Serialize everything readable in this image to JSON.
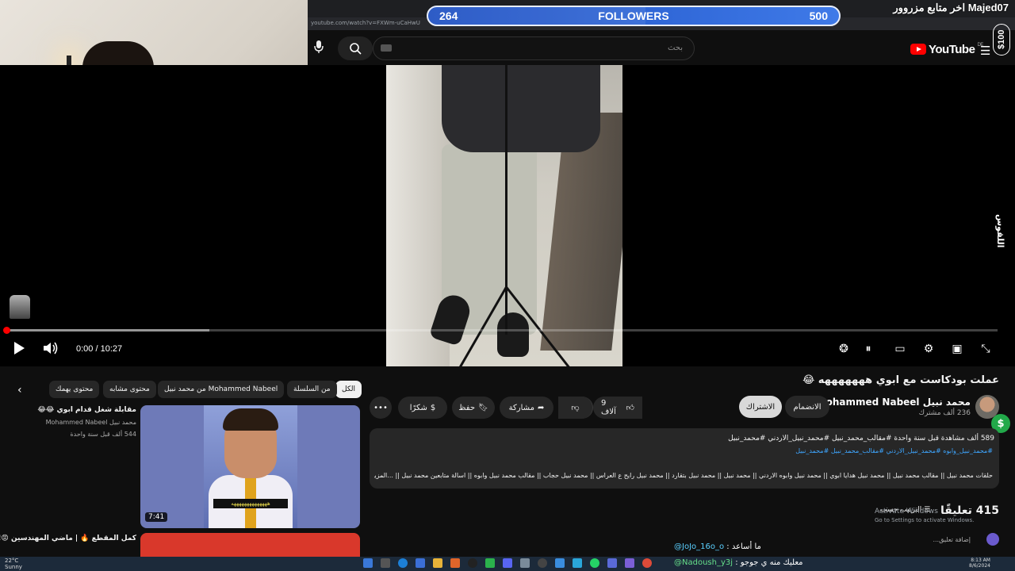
{
  "stream_overlay": {
    "followers_current": "264",
    "followers_label": "FOLLOWERS",
    "followers_goal": "500",
    "followers_progress": 0.528,
    "last_follower": "اخر متابع مزروور Majed07",
    "donation_amount": "$100",
    "vertical_label": "اللقوس",
    "dollar_badge": "$"
  },
  "browser": {
    "url": "youtube.com/watch?v=FXWm-uCaHwU"
  },
  "header": {
    "search_placeholder": "بحث",
    "logo_text": "YouTube",
    "logo_region": "DE"
  },
  "player": {
    "time": "0:00 / 10:27",
    "progress": 0.0
  },
  "video": {
    "title": "عملت بودكاست مع ابوي هههههههه 😂",
    "channel_name": "محمد نبيل Mohammed Nabeel",
    "subscribers": "236 ألف مشترك",
    "join_label": "الانضمام",
    "subscribe_label": "الاشتراك",
    "like_count": "9 آلاف",
    "share_label": "مشاركة",
    "save_label": "حفظ",
    "thanks_label": "شكرًا",
    "more_label": "•••"
  },
  "description": {
    "views": "589 ألف مشاهدة  قبل سنة واحدة  #مقالب_محمد_نبيل #محمد_نبيل_الاردني #محمد_نبيل",
    "tags": "#محمد_نبيل_وابوه #محمد_نبيل_الاردني #مقالب_محمد_نبيل #محمد_نبيل",
    "text": "حلقات محمد نبيل || مقالب محمد نبيل || محمد نبيل هدايا ابوي || محمد نبيل وابوه الاردني || محمد نبيل || محمد نبيل بتقارد || محمد نبيل رايح ع العراس || محمد نبيل حجاب || مقالب محمد نبيل وابوه || اسالة متابعين محمد نبيل || ...المزيد"
  },
  "comments": {
    "count": "415 تعليقًا",
    "sort_label": "الترتيب حسب",
    "add_placeholder": "إضافة تعليق..."
  },
  "watermark": {
    "line1": "Activate Windows",
    "line2": "Go to Settings to activate Windows."
  },
  "chips": [
    {
      "label": "الكل",
      "active": true
    },
    {
      "label": "من السلسلة",
      "active": false
    },
    {
      "label": "من محمد نبيل Mohammed Nabeel",
      "active": false
    },
    {
      "label": "محتوى مشابه",
      "active": false
    },
    {
      "label": "محتوى يهمك",
      "active": false
    }
  ],
  "recommended": {
    "title": "مقابلة شغل قدام ابوي 😂😂",
    "channel": "محمد نبيل Mohammed Nabeel",
    "meta": "544 ألف  قبل سنة واحدة",
    "duration": "7:41",
    "thumb_caption": "ههههههههههههههه",
    "second_title": "كمل المقطع 🔥 | ماضي المهندسين 😡!"
  },
  "chat": [
    {
      "user": "@JoJo_16o_o",
      "message": " : ما أساعد"
    },
    {
      "user": "@Nadoush_y3j",
      "message": " : معليك منه ي جوجو"
    }
  ],
  "taskbar": {
    "weather": "22°C",
    "weather_sub": "Sunny",
    "time": "8:13 AM",
    "date": "8/6/2024"
  },
  "colors": {
    "youtube_red": "#ff0000",
    "followers_bar": "#2f6ae0",
    "link_blue": "#3ea6ff",
    "background": "#0f0f0f"
  }
}
